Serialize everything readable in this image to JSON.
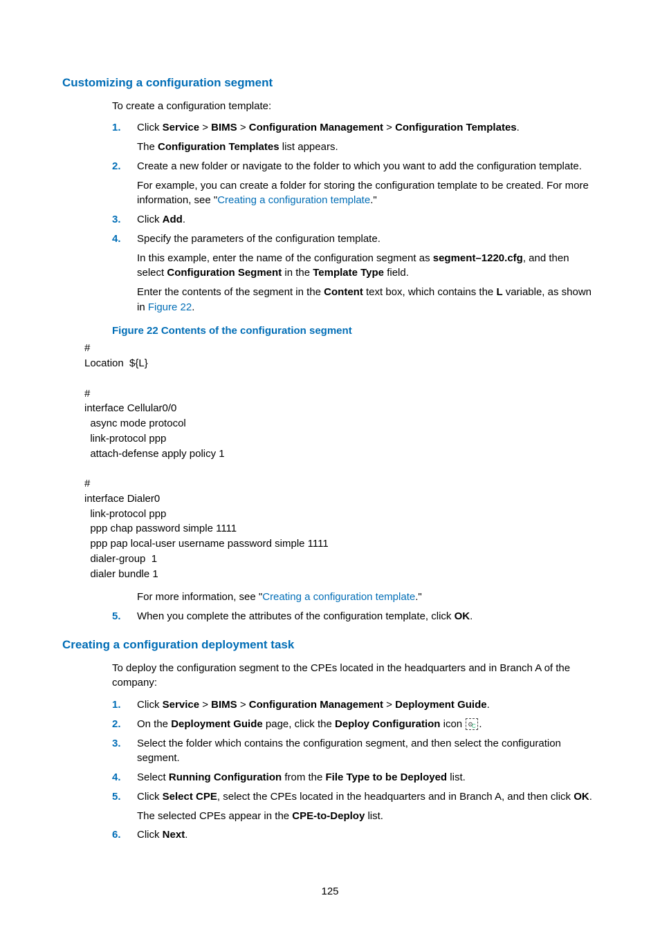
{
  "section1": {
    "heading": "Customizing a configuration segment",
    "intro": "To create a configuration template:",
    "steps": {
      "s1": {
        "num": "1.",
        "prefix": "Click ",
        "b1": "Service",
        "gt1": " > ",
        "b2": "BIMS",
        "gt2": " > ",
        "b3": "Configuration Management",
        "gt3": " > ",
        "b4": "Configuration Templates",
        "suffix": ".",
        "p2a": "The ",
        "p2b": "Configuration Templates",
        "p2c": " list appears."
      },
      "s2": {
        "num": "2.",
        "p1": "Create a new folder or navigate to the folder to which you want to add the configuration template.",
        "p2a": "For example, you can create a folder for storing the configuration template to be created. For more information, see \"",
        "p2link": "Creating a configuration template",
        "p2b": ".\""
      },
      "s3": {
        "num": "3.",
        "a": "Click ",
        "b": "Add",
        "c": "."
      },
      "s4": {
        "num": "4.",
        "p1": "Specify the parameters of the configuration template.",
        "p2a": "In this example, enter the name of the configuration segment as ",
        "p2b": "segment–1220.cfg",
        "p2c": ", and then select ",
        "p2d": "Configuration Segment",
        "p2e": " in the ",
        "p2f": "Template Type",
        "p2g": " field.",
        "p3a": "Enter the contents of the segment in the ",
        "p3b": "Content",
        "p3c": " text box, which contains the ",
        "p3d": "L",
        "p3e": " variable, as shown in ",
        "p3link": "Figure 22",
        "p3f": "."
      },
      "s5": {
        "num": "5.",
        "a": "When you complete the attributes of the configuration template, click ",
        "b": "OK",
        "c": "."
      }
    },
    "figCaption": "Figure 22 Contents of the configuration segment",
    "code": "#\nLocation  ${L}\n\n#\ninterface Cellular0/0\n  async mode protocol\n  link-protocol ppp\n  attach-defense apply policy 1\n\n#\ninterface Dialer0\n  link-protocol ppp\n  ppp chap password simple 1111\n  ppp pap local-user username password simple 1111\n  dialer-group  1\n  dialer bundle 1",
    "afterCodeA": "For more information, see \"",
    "afterCodeLink": "Creating a configuration template",
    "afterCodeB": ".\""
  },
  "section2": {
    "heading": "Creating a configuration deployment task",
    "intro": "To deploy the configuration segment to the CPEs located in the headquarters and in Branch A of the company:",
    "steps": {
      "s1": {
        "num": "1.",
        "prefix": "Click ",
        "b1": "Service",
        "gt1": " > ",
        "b2": "BIMS",
        "gt2": " > ",
        "b3": "Configuration Management",
        "gt3": " > ",
        "b4": "Deployment Guide",
        "suffix": "."
      },
      "s2": {
        "num": "2.",
        "a": "On the ",
        "b": "Deployment Guide",
        "c": " page, click the ",
        "d": "Deploy Configuration",
        "e": " icon ",
        "f": "."
      },
      "s3": {
        "num": "3.",
        "p1": "Select the folder which contains the configuration segment, and then select the configuration segment."
      },
      "s4": {
        "num": "4.",
        "a": "Select ",
        "b": "Running Configuration",
        "c": " from the ",
        "d": "File Type to be Deployed",
        "e": " list."
      },
      "s5": {
        "num": "5.",
        "a": "Click ",
        "b": "Select CPE",
        "c": ", select the CPEs located in the headquarters and in Branch A, and then click ",
        "d": "OK",
        "e": ".",
        "p2a": "The selected CPEs appear in the ",
        "p2b": "CPE-to-Deploy",
        "p2c": " list."
      },
      "s6": {
        "num": "6.",
        "a": "Click ",
        "b": "Next",
        "c": "."
      }
    }
  },
  "pageNumber": "125"
}
